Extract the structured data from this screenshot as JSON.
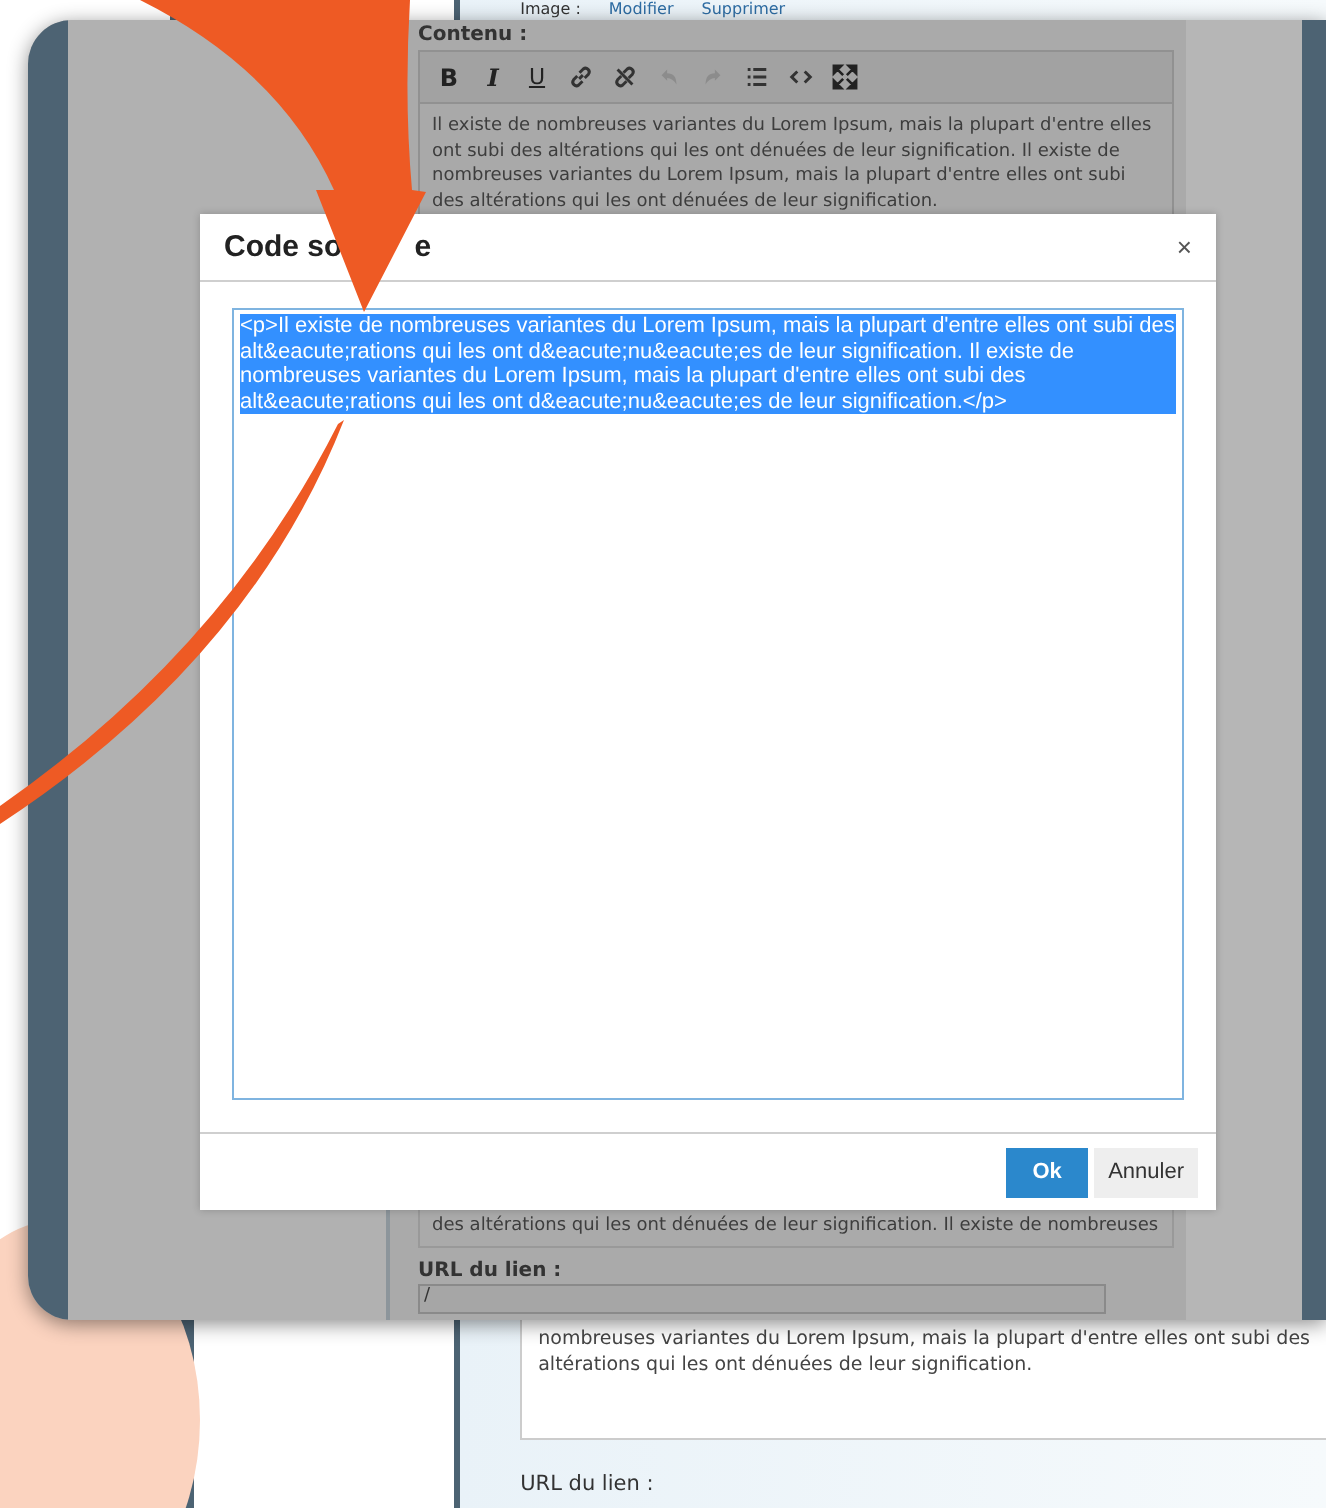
{
  "background_page": {
    "image_label": "Image :",
    "image_links": [
      "Modifier",
      "Supprimer"
    ],
    "text_lines": [
      "nombreuses variantes du Lorem Ipsum, mais la plupart d'entre elles ont subi des",
      "altérations qui les ont dénuées de leur signification."
    ],
    "url_label": "URL du lien :"
  },
  "editor": {
    "label": "Contenu :",
    "toolbar": [
      {
        "kind": "bold",
        "label": "B",
        "disabled": false
      },
      {
        "kind": "italic",
        "label": "I",
        "disabled": false
      },
      {
        "kind": "underline",
        "label": "U",
        "disabled": false
      },
      {
        "kind": "link",
        "disabled": false
      },
      {
        "kind": "unlink",
        "disabled": false
      },
      {
        "kind": "undo",
        "disabled": true
      },
      {
        "kind": "redo",
        "disabled": true
      },
      {
        "kind": "list",
        "disabled": false
      },
      {
        "kind": "code",
        "disabled": false
      },
      {
        "kind": "fullscreen",
        "disabled": false
      }
    ],
    "text": "Il existe de nombreuses variantes du Lorem Ipsum, mais la plupart d'entre elles ont subi des altérations qui les ont dénuées de leur signification. Il existe de nombreuses variantes du Lorem Ipsum, mais la plupart d'entre elles ont subi des altérations qui les ont dénuées de leur signification."
  },
  "dialog": {
    "title": "Code so",
    "title_tail": "e",
    "close": "×",
    "source": "<p>Il existe de nombreuses variantes du Lorem Ipsum, mais la plupart d'entre elles ont subi des alt&eacute;rations qui les ont d&eacute;nu&eacute;es de leur signification. Il existe de nombreuses variantes du Lorem Ipsum, mais la plupart d'entre elles ont subi des alt&eacute;rations qui les ont d&eacute;nu&eacute;es de leur signification.</p>",
    "source_selected": true,
    "buttons": [
      {
        "label": "Ok",
        "kind": "primary"
      },
      {
        "label": "Annuler",
        "kind": "secondary"
      }
    ]
  },
  "below_dialog": {
    "text_line": "des altérations qui les ont dénuées de leur signification. Il existe de nombreuses",
    "url_label": "URL du lien :",
    "url_value": "/"
  }
}
